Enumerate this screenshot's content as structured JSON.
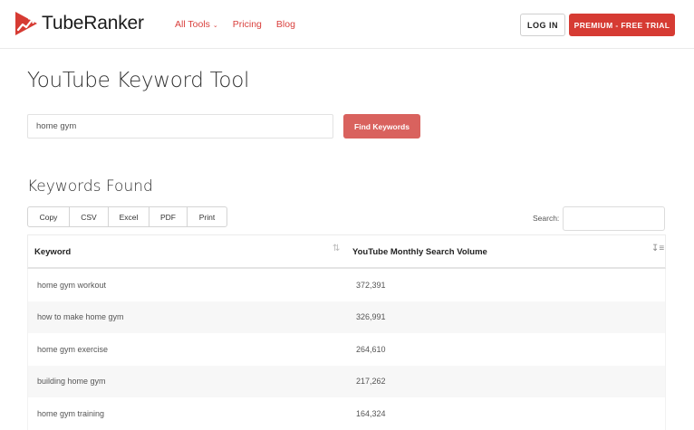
{
  "header": {
    "brand": "TubeRanker",
    "nav": [
      {
        "label": "All Tools",
        "has_caret": true
      },
      {
        "label": "Pricing"
      },
      {
        "label": "Blog"
      }
    ],
    "login_label": "LOG IN",
    "premium_label": "PREMIUM - FREE TRIAL"
  },
  "page": {
    "title": "YouTube Keyword Tool"
  },
  "search": {
    "value": "home gym",
    "button_label": "Find Keywords"
  },
  "results": {
    "title": "Keywords Found",
    "export_buttons": [
      "Copy",
      "CSV",
      "Excel",
      "PDF",
      "Print"
    ],
    "filter_label": "Search:",
    "filter_value": "",
    "columns": [
      "Keyword",
      "YouTube Monthly Search Volume"
    ],
    "rows": [
      {
        "keyword": "home gym workout",
        "volume": "372,391"
      },
      {
        "keyword": "how to make home gym",
        "volume": "326,991"
      },
      {
        "keyword": "home gym exercise",
        "volume": "264,610"
      },
      {
        "keyword": "building home gym",
        "volume": "217,262"
      },
      {
        "keyword": "home gym training",
        "volume": "164,324"
      }
    ]
  },
  "colors": {
    "brand_red": "#d63b33",
    "find_button": "#d9625e",
    "nav_link": "#d9403d"
  },
  "icons": {
    "logo": "play-trend-icon",
    "caret": "chevron-down-icon",
    "sort_neutral": "sort-icon",
    "sort_desc": "sort-desc-icon"
  }
}
